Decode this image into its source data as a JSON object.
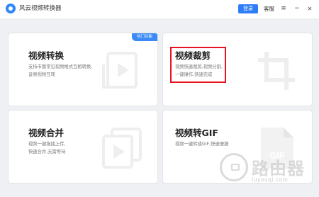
{
  "app": {
    "title": "风云视频转换器",
    "login_label": "登录",
    "service_label": "客服",
    "menu_icon": "≡",
    "minimize_icon": "−",
    "close_icon": "✕"
  },
  "cards": [
    {
      "title": "视频转换",
      "desc": [
        "支持市面常见视频格式互相转换,",
        "音频视频互转"
      ],
      "badge": "热门功能",
      "icon": "play-icon"
    },
    {
      "title": "视频裁剪",
      "desc": [
        "视频快速裁剪,视频分割,",
        "一键操作,快速完成"
      ],
      "icon": "crop-icon"
    },
    {
      "title": "视频合并",
      "desc": [
        "视频一键拖拽上传,",
        "快速合并,无需等待"
      ],
      "icon": "merge-icon"
    },
    {
      "title": "视频转GIF",
      "desc": [
        "视频一键转成GIF,快速便捷"
      ],
      "icon": "gif-file-icon",
      "icon_text": "GIF"
    }
  ],
  "watermark": {
    "text": "路由器",
    "sub": "luyouqi.com"
  },
  "colors": {
    "accent": "#2f7df6",
    "highlight": "#e8131e",
    "icon_gray": "#f0f0f0"
  }
}
